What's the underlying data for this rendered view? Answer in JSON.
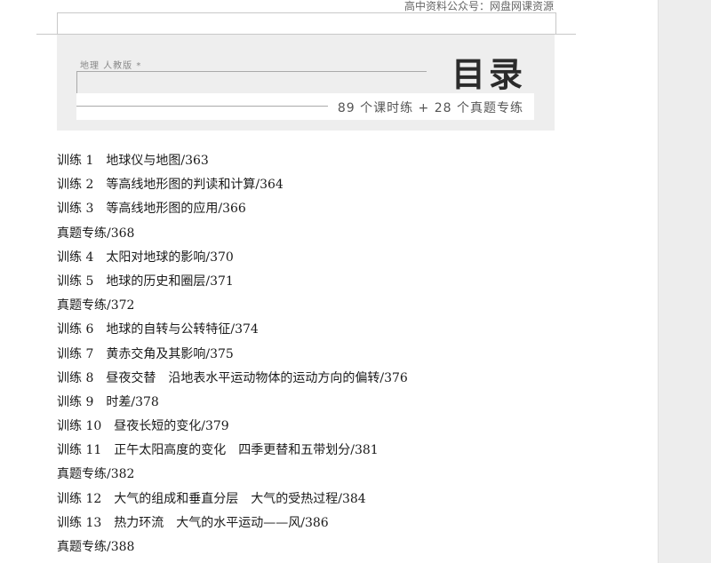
{
  "header": {
    "text": "高中资料公众号：网盘网课资源"
  },
  "banner": {
    "subject": "地理 人教版 *",
    "title": "目录",
    "subtitle": "89 个课时练 + 28 个真题专练"
  },
  "toc": [
    "训练 1　地球仪与地图/363",
    "训练 2　等高线地形图的判读和计算/364",
    "训练 3　等高线地形图的应用/366",
    "真题专练/368",
    "训练 4　太阳对地球的影响/370",
    "训练 5　地球的历史和圈层/371",
    "真题专练/372",
    "训练 6　地球的自转与公转特征/374",
    "训练 7　黄赤交角及其影响/375",
    "训练 8　昼夜交替　沿地表水平运动物体的运动方向的偏转/376",
    "训练 9　时差/378",
    "训练 10　昼夜长短的变化/379",
    "训练 11　正午太阳高度的变化　四季更替和五带划分/381",
    "真题专练/382",
    "训练 12　大气的组成和垂直分层　大气的受热过程/384",
    "训练 13　热力环流　大气的水平运动——风/386",
    "真题专练/388"
  ]
}
